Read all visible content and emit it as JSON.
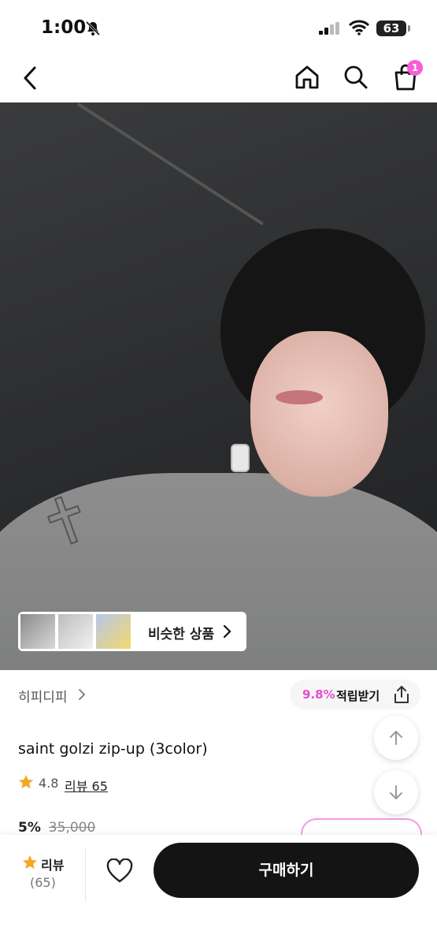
{
  "status": {
    "time": "1:00",
    "battery": "63"
  },
  "nav": {
    "cart_count": "1"
  },
  "hero": {
    "similar_label": "비슷한 상품"
  },
  "product": {
    "brand": "히피디피",
    "points_percent": "9.8%",
    "points_label": "적립받기",
    "title": "saint golzi zip-up (3color)",
    "rating": "4.8",
    "review_link": "리뷰 65",
    "discount": "5%",
    "original_price": "35,000"
  },
  "bottom": {
    "review_label": "리뷰",
    "review_count": "(65)",
    "buy_label": "구매하기"
  },
  "colors": {
    "accent": "#E64CD0",
    "badge": "#F55FD7",
    "buy_button": "#141414"
  }
}
